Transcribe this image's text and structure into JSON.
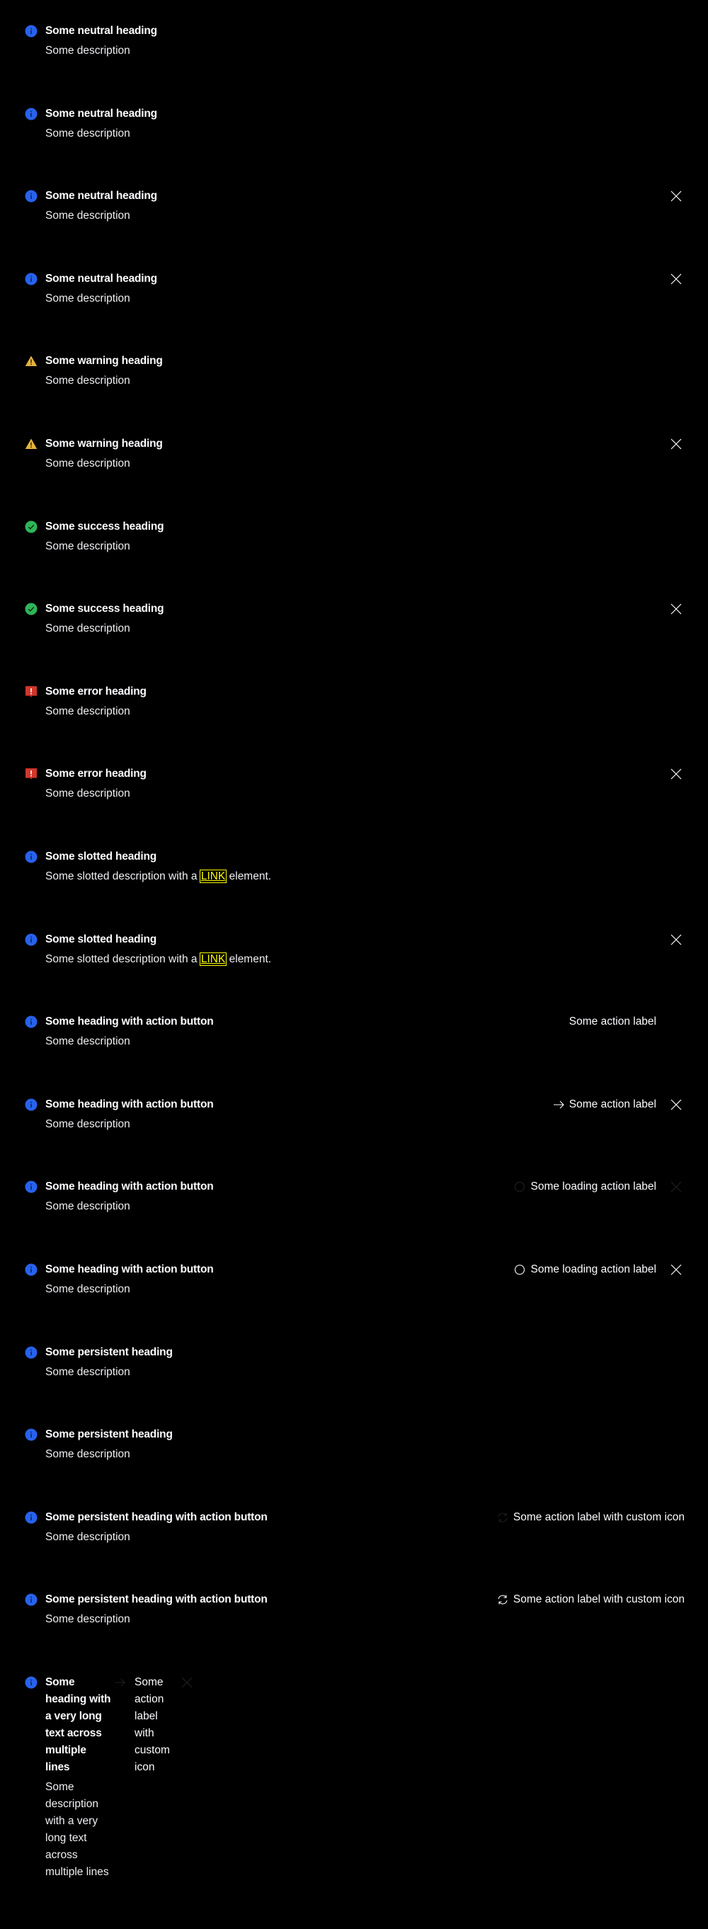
{
  "colors": {
    "info": "#2762ec",
    "warning": "#e4b33c",
    "success": "#2fb559",
    "error": "#d2362b"
  },
  "rows": [
    {
      "variant": "info",
      "heading": "Some neutral heading",
      "description": "Some description",
      "close": "none"
    },
    {
      "variant": "info",
      "heading": "Some neutral heading",
      "description": "Some description",
      "close": "none"
    },
    {
      "variant": "info",
      "heading": "Some neutral heading",
      "description": "Some description",
      "close": "visible"
    },
    {
      "variant": "info",
      "heading": "Some neutral heading",
      "description": "Some description",
      "close": "visible"
    },
    {
      "variant": "warning",
      "heading": "Some warning heading",
      "description": "Some description",
      "close": "none"
    },
    {
      "variant": "warning",
      "heading": "Some warning heading",
      "description": "Some description",
      "close": "visible"
    },
    {
      "variant": "success",
      "heading": "Some success heading",
      "description": "Some description",
      "close": "none"
    },
    {
      "variant": "success",
      "heading": "Some success heading",
      "description": "Some description",
      "close": "visible"
    },
    {
      "variant": "error",
      "heading": "Some error heading",
      "description": "Some description",
      "close": "none"
    },
    {
      "variant": "error",
      "heading": "Some error heading",
      "description": "Some description",
      "close": "visible"
    },
    {
      "variant": "info",
      "heading": "Some slotted heading",
      "description": "Some slotted description with a",
      "link": "LINK",
      "description_after": "element.",
      "close": "none"
    },
    {
      "variant": "info",
      "heading": "Some slotted heading",
      "description": "Some slotted description with a",
      "link": "LINK",
      "description_after": "element.",
      "close": "visible"
    },
    {
      "variant": "info",
      "heading": "Some heading with action button",
      "description": "Some description",
      "action": {
        "label": "Some action label",
        "icon": "none"
      },
      "close": "hidden"
    },
    {
      "variant": "info",
      "heading": "Some heading with action button",
      "description": "Some description",
      "action": {
        "label": "Some action label",
        "icon": "arrow-right-icon"
      },
      "close": "visible"
    },
    {
      "variant": "info",
      "heading": "Some heading with action button",
      "description": "Some description",
      "action": {
        "label": "Some loading action label",
        "icon": "spinner-icon-faint"
      },
      "close": "faint"
    },
    {
      "variant": "info",
      "heading": "Some heading with action button",
      "description": "Some description",
      "action": {
        "label": "Some loading action label",
        "icon": "spinner-icon"
      },
      "close": "visible"
    },
    {
      "variant": "info",
      "heading": "Some persistent heading",
      "description": "Some description",
      "close": "none"
    },
    {
      "variant": "info",
      "heading": "Some persistent heading",
      "description": "Some description",
      "close": "none"
    },
    {
      "variant": "info",
      "heading": "Some persistent heading with action button",
      "description": "Some description",
      "action": {
        "label": "Some action label with custom icon",
        "icon": "reload-icon-faint"
      },
      "close": "none"
    },
    {
      "variant": "info",
      "heading": "Some persistent heading with action button",
      "description": "Some description",
      "action": {
        "label": "Some action label with custom icon",
        "icon": "reload-icon"
      },
      "close": "none"
    },
    {
      "variant": "info",
      "heading": "Some heading with a very long text across multiple lines",
      "description": "Some description with a very long text across multiple lines",
      "action": {
        "label": "Some action label with custom icon",
        "icon": "arrow-right-icon-faint"
      },
      "close": "faint",
      "narrow": true
    }
  ]
}
